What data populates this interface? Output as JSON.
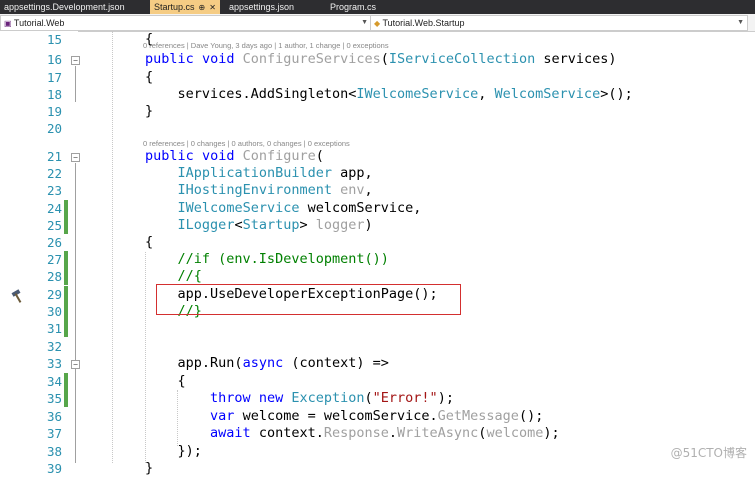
{
  "tabs": [
    {
      "label": "appsettings.Development.json",
      "active": false
    },
    {
      "label": "Startup.cs",
      "active": true
    },
    {
      "label": "appsettings.json",
      "active": false
    },
    {
      "label": "Program.cs",
      "active": false
    }
  ],
  "nav": {
    "project": "Tutorial.Web",
    "class": "Tutorial.Web.Startup"
  },
  "lenses": {
    "configure_services": "0 references | Dave Young, 3 days ago | 1 author, 1 change | 0 exceptions",
    "configure": "0 references | 0 changes | 0 authors, 0 changes | 0 exceptions"
  },
  "lines": [
    {
      "n": "15",
      "t": "        {"
    },
    {
      "n": "16",
      "t": "        public void ConfigureServices(IServiceCollection services)"
    },
    {
      "n": "17",
      "t": "        {"
    },
    {
      "n": "18",
      "t": "            services.AddSingleton<IWelcomeService, WelcomService>();"
    },
    {
      "n": "19",
      "t": "        }"
    },
    {
      "n": "20",
      "t": ""
    },
    {
      "n": "21",
      "t": "        public void Configure("
    },
    {
      "n": "22",
      "t": "            IApplicationBuilder app,"
    },
    {
      "n": "23",
      "t": "            IHostingEnvironment env,"
    },
    {
      "n": "24",
      "t": "            IWelcomeService welcomService,"
    },
    {
      "n": "25",
      "t": "            ILogger<Startup> logger)"
    },
    {
      "n": "26",
      "t": "        {"
    },
    {
      "n": "27",
      "t": "            //if (env.IsDevelopment())"
    },
    {
      "n": "28",
      "t": "            //{"
    },
    {
      "n": "29",
      "t": "            app.UseDeveloperExceptionPage();"
    },
    {
      "n": "30",
      "t": "            //}"
    },
    {
      "n": "31",
      "t": ""
    },
    {
      "n": "32",
      "t": ""
    },
    {
      "n": "33",
      "t": "            app.Run(async (context) =>"
    },
    {
      "n": "34",
      "t": "            {"
    },
    {
      "n": "35",
      "t": "                throw new Exception(\"Error!\");"
    },
    {
      "n": "36",
      "t": "                var welcome = welcomService.GetMessage();"
    },
    {
      "n": "37",
      "t": "                await context.Response.WriteAsync(welcome);"
    },
    {
      "n": "38",
      "t": "            });"
    },
    {
      "n": "39",
      "t": "        }"
    }
  ],
  "colors": {
    "keyword": "#0000ff",
    "type": "#2b91af",
    "string": "#a31515",
    "comment": "#008000",
    "changed": "#57a64a",
    "highlight": "#d32f2f"
  },
  "watermark": "@51CTO博客"
}
